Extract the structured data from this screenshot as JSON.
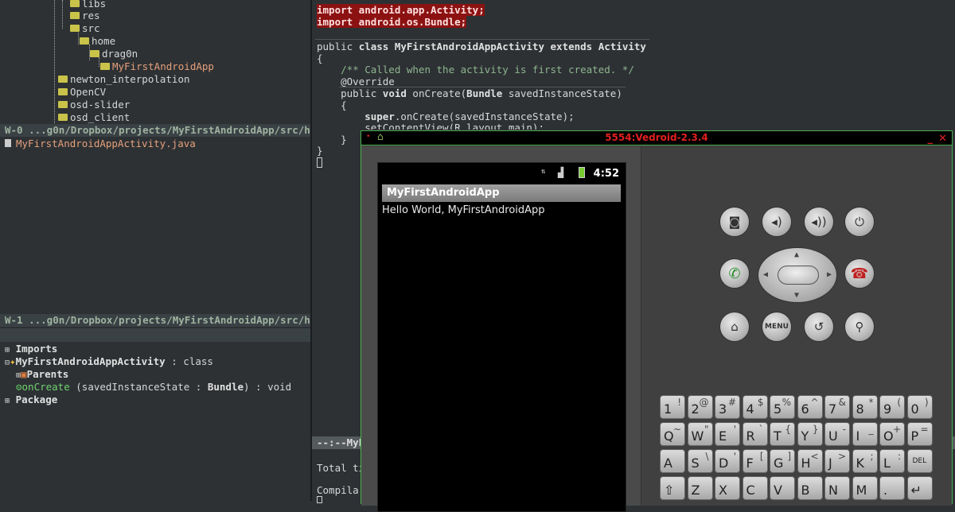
{
  "tree": {
    "items": [
      {
        "label": "libs",
        "indent": 2
      },
      {
        "label": "res",
        "indent": 2
      },
      {
        "label": "src",
        "indent": 2
      },
      {
        "label": "home",
        "indent": 3
      },
      {
        "label": "drag0n",
        "indent": 4
      },
      {
        "label": "MyFirstAndroidApp",
        "indent": 5
      },
      {
        "label": "newton_interpolation",
        "indent": 1
      },
      {
        "label": "OpenCV",
        "indent": 1
      },
      {
        "label": "osd-slider",
        "indent": 1
      },
      {
        "label": "osd_client",
        "indent": 1
      }
    ]
  },
  "modeline0": "W-0 ...g0n/Dropbox/projects/MyFirstAndroidApp/src/h",
  "file_entry": "MyFirstAndroidAppActivity.java",
  "modeline1": "W-1 ...g0n/Dropbox/projects/MyFirstAndroidApp/src/h",
  "outline": {
    "imports": "Imports",
    "class_name": "MyFirstAndroidAppActivity",
    "class_suffix": " : class",
    "parents": "Parents",
    "method_name": "onCreate",
    "method_args": " (savedInstanceState : ",
    "method_type": "Bundle",
    "method_ret": ") : void",
    "package": "Package"
  },
  "code": {
    "import1": "import android.app.Activity;",
    "import2": "import android.os.Bundle;",
    "class_decl_pre": "public ",
    "class_decl_kw": "class MyFirstAndroidAppActivity extends Activity",
    "brace_open": "{",
    "comment": "    /** Called when the activity is first created. */",
    "override": "    @Override",
    "method_pre": "    public ",
    "method_kw": "void",
    "method_mid": " onCreate(",
    "method_type": "Bundle",
    "method_post": " savedInstanceState)",
    "inner_brace": "    {",
    "super_call_kw": "super",
    "super_call_rest": ".onCreate(savedInstanceState);",
    "setcontent": "        setContentView(R.layout.main);",
    "inner_close": "    }",
    "close": "}"
  },
  "editor_modeline": "--:--MyFi",
  "compile": {
    "line1": "Total ti",
    "line2": "Compila"
  },
  "emulator": {
    "title": "5554:Vedroid-2.3.4",
    "clock": "4:52",
    "app_title": "MyFirstAndroidApp",
    "hello_text": "Hello World, MyFirstAndroidApp",
    "menu_label": "MENU"
  },
  "keyboard": {
    "row1": [
      [
        "1",
        "!"
      ],
      [
        "2",
        "@"
      ],
      [
        "3",
        "#"
      ],
      [
        "4",
        "$"
      ],
      [
        "5",
        "%"
      ],
      [
        "6",
        "^"
      ],
      [
        "7",
        "&"
      ],
      [
        "8",
        "*"
      ],
      [
        "9",
        "("
      ],
      [
        "0",
        ")"
      ]
    ],
    "row2": [
      [
        "Q",
        "~"
      ],
      [
        "W",
        "\""
      ],
      [
        "E",
        "'"
      ],
      [
        "R",
        "`"
      ],
      [
        "T",
        "{"
      ],
      [
        "Y",
        "}"
      ],
      [
        "U",
        "-"
      ],
      [
        "I",
        "_"
      ],
      [
        "O",
        "+"
      ],
      [
        "P",
        "="
      ]
    ],
    "row3": [
      [
        "A",
        ""
      ],
      [
        "S",
        "\\"
      ],
      [
        "D",
        "'"
      ],
      [
        "F",
        "["
      ],
      [
        "G",
        "]"
      ],
      [
        "H",
        "<"
      ],
      [
        "J",
        ">"
      ],
      [
        "K",
        ";"
      ],
      [
        "L",
        ":"
      ],
      [
        "DEL",
        ""
      ]
    ],
    "row4": [
      [
        "⇧",
        ""
      ],
      [
        "Z",
        ""
      ],
      [
        "X",
        ""
      ],
      [
        "C",
        ""
      ],
      [
        "V",
        ""
      ],
      [
        "B",
        ""
      ],
      [
        "N",
        ""
      ],
      [
        "M",
        ""
      ],
      [
        ".",
        ""
      ],
      [
        "↵",
        ""
      ]
    ]
  },
  "colors": {
    "accent_green": "#4caf50",
    "title_red": "#e02020",
    "import_bg": "#8c1212"
  }
}
